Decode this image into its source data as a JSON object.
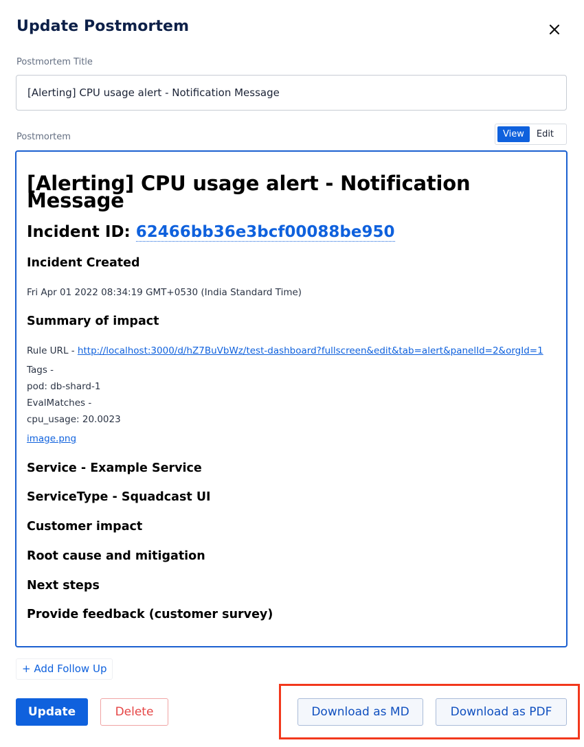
{
  "modal": {
    "title": "Update Postmortem",
    "close_icon": "close-icon"
  },
  "title_field": {
    "label": "Postmortem Title",
    "value": "[Alerting] CPU usage alert - Notification Message"
  },
  "postmortem_field": {
    "label": "Postmortem",
    "view_label": "View",
    "edit_label": "Edit",
    "active_mode": "View"
  },
  "document": {
    "heading": "[Alerting] CPU usage alert - Notification Message",
    "incident_label": "Incident ID: ",
    "incident_id": "62466bb36e3bcf00088be950",
    "incident_created_heading": "Incident Created",
    "incident_created_value": "Fri Apr 01 2022 08:34:19 GMT+0530 (India Standard Time)",
    "summary_heading": "Summary of impact",
    "rule_url_label": "Rule URL - ",
    "rule_url": "http://localhost:3000/d/hZ7BuVbWz/test-dashboard?fullscreen&edit&tab=alert&panelId=2&orgId=1",
    "tags_label": "Tags -",
    "tag_value": "pod: db-shard-1",
    "eval_label": "EvalMatches -",
    "eval_value": "cpu_usage: 20.0023",
    "image_link": "image.png",
    "service": "Service - Example Service",
    "service_type": "ServiceType - Squadcast UI",
    "customer_impact": "Customer impact",
    "root_cause": "Root cause and mitigation",
    "next_steps": "Next steps",
    "feedback": "Provide feedback (customer survey)"
  },
  "actions": {
    "add_follow_up": "+ Add Follow Up",
    "update": "Update",
    "delete": "Delete",
    "download_md": "Download as MD",
    "download_pdf": "Download as PDF"
  },
  "colors": {
    "primary": "#0f61dd",
    "danger": "#e54545",
    "highlight": "#f2381c",
    "title": "#0d2048"
  }
}
